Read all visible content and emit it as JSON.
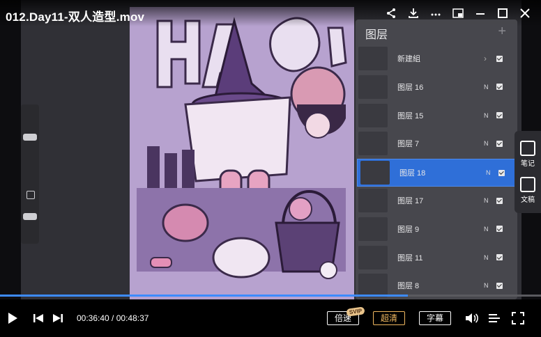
{
  "title": "012.Day11-双人造型.mov",
  "toolbar_icons": [
    "share-icon",
    "download-icon",
    "more-icon",
    "pip-icon",
    "minimize-icon",
    "maximize-icon",
    "close-icon"
  ],
  "layers": {
    "header": "图层",
    "add_symbol": "+",
    "items": [
      {
        "name": "新建組",
        "mode": "",
        "visible": true,
        "group": true
      },
      {
        "name": "图层 16",
        "mode": "N",
        "visible": true
      },
      {
        "name": "图层 15",
        "mode": "N",
        "visible": true
      },
      {
        "name": "图层 7",
        "mode": "N",
        "visible": true
      },
      {
        "name": "图层 18",
        "mode": "N",
        "visible": true,
        "active": true
      },
      {
        "name": "图层 17",
        "mode": "N",
        "visible": true
      },
      {
        "name": "图层 9",
        "mode": "N",
        "visible": true
      },
      {
        "name": "图层 11",
        "mode": "N",
        "visible": true
      },
      {
        "name": "图层 8",
        "mode": "N",
        "visible": true
      }
    ]
  },
  "float_panel": {
    "notes_label": "笔记",
    "docs_label": "文稿"
  },
  "player": {
    "current_time": "00:36:40",
    "total_time": "00:48:37",
    "time_sep": " / ",
    "progress": 0.754,
    "speed_label": "倍速",
    "quality_label": "超清",
    "subtitle_label": "字幕",
    "svip_badge": "SVIP"
  },
  "colors": {
    "accent": "#3d8bff",
    "active_layer": "#2f6fd8",
    "hd": "#f0b860"
  }
}
